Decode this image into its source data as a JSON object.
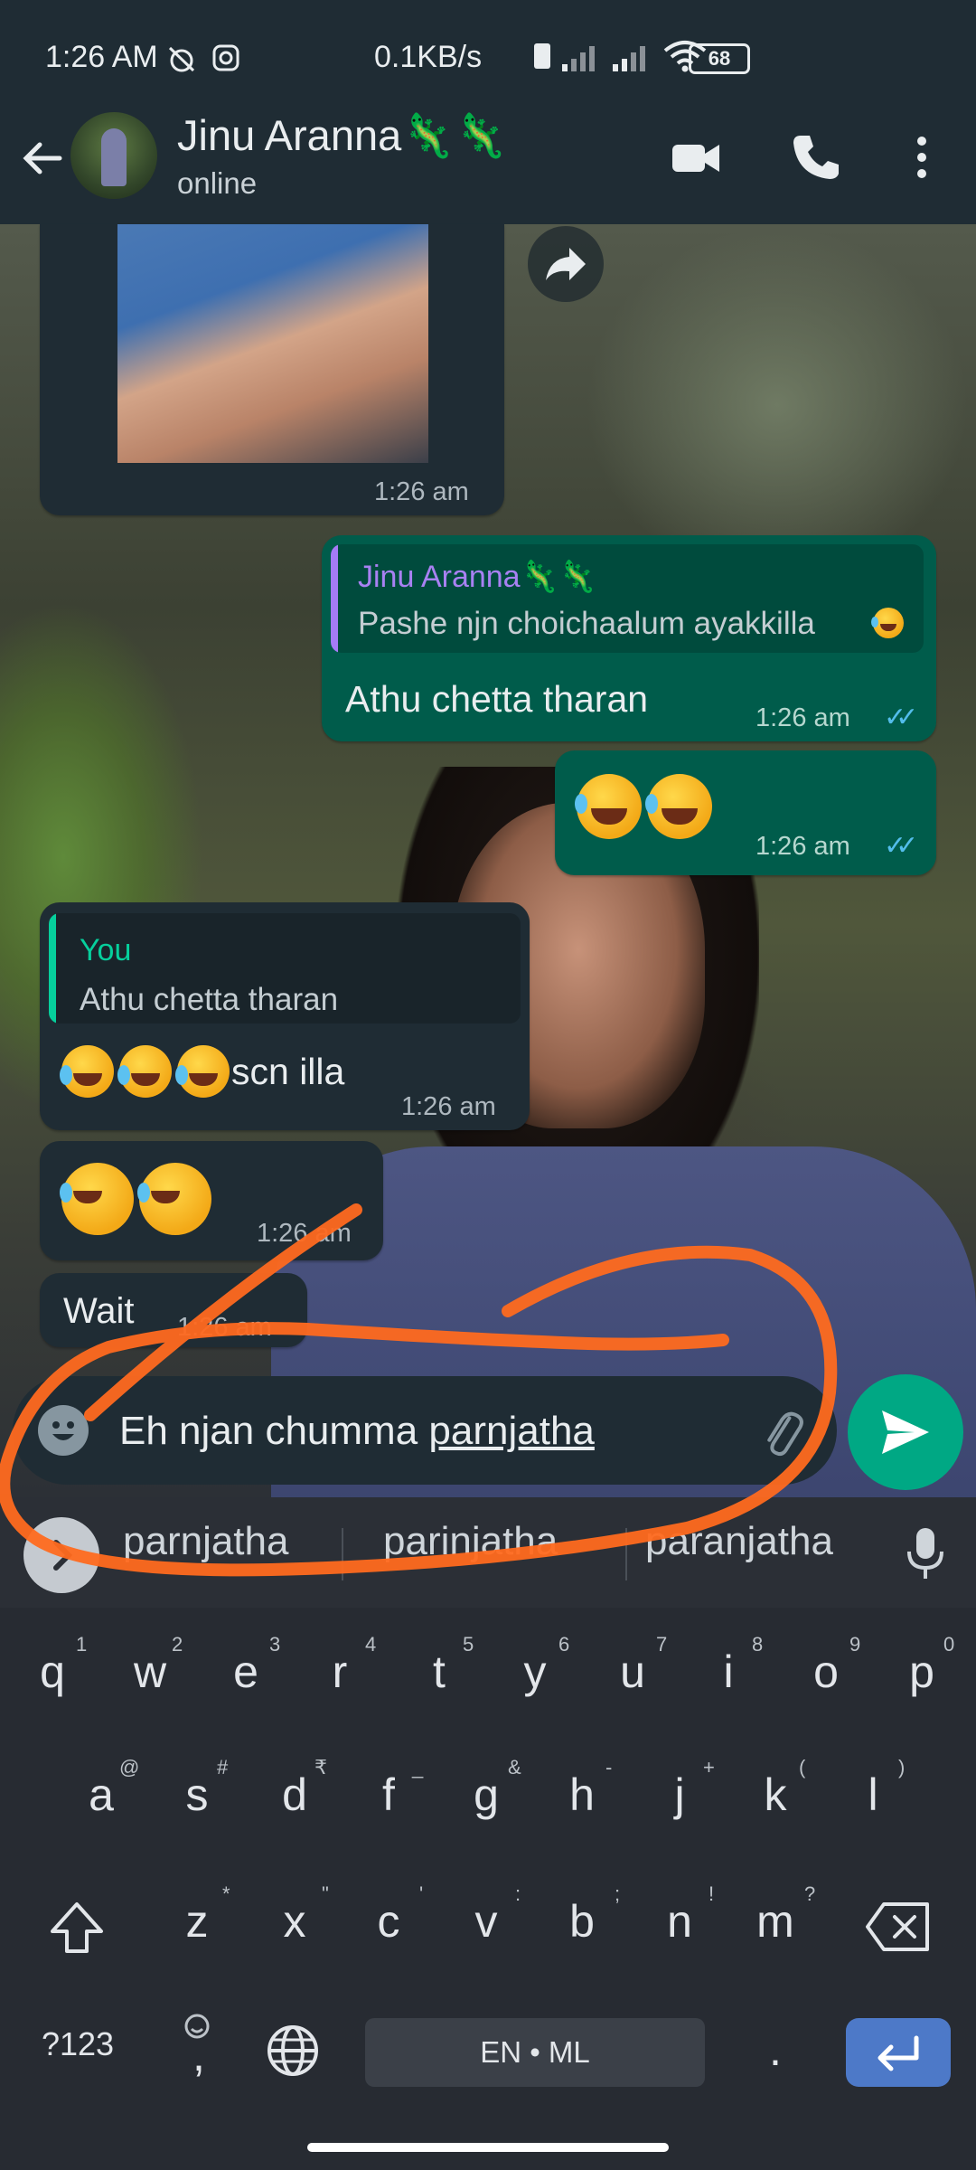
{
  "status_bar": {
    "time": "1:26 AM",
    "network_speed": "0.1KB/s",
    "battery": "68",
    "icons": [
      "alarm-icon",
      "instagram-icon",
      "volte-icon",
      "signal-icon",
      "signal-icon",
      "wifi-icon",
      "battery-icon"
    ]
  },
  "header": {
    "contact_name": "Jinu Aranna🦎🦎",
    "status": "online",
    "icons": [
      "back-arrow-icon",
      "video-call-icon",
      "voice-call-icon",
      "more-vert-icon"
    ]
  },
  "messages": [
    {
      "type": "image",
      "direction": "in",
      "time": "1:26 am"
    },
    {
      "type": "reply",
      "direction": "out",
      "quoted_name": "Jinu Aranna🦎🦎",
      "quoted_text": "Pashe njn choichaalum ayakkilla",
      "text": "Athu chetta tharan",
      "time": "1:26 am",
      "status": "read"
    },
    {
      "type": "emoji",
      "direction": "out",
      "emoji_count": 2,
      "time": "1:26 am",
      "status": "read"
    },
    {
      "type": "reply",
      "direction": "in",
      "quoted_name": "You",
      "quoted_text": "Athu chetta tharan",
      "text": "scn illa",
      "emoji_count": 3,
      "time": "1:26 am"
    },
    {
      "type": "emoji",
      "direction": "in",
      "emoji_count": 2,
      "time": "1:26 am"
    },
    {
      "type": "text",
      "direction": "in",
      "text": "Wait",
      "time": "1:26 am"
    }
  ],
  "composer": {
    "text_start": "Eh njan chumma ",
    "text_word": "parnjatha",
    "icons": [
      "emoji-icon",
      "attach-icon",
      "send-icon"
    ]
  },
  "keyboard": {
    "suggestions": [
      "parnjatha",
      "parinjatha",
      "paranjatha"
    ],
    "row1": [
      "q",
      "w",
      "e",
      "r",
      "t",
      "y",
      "u",
      "i",
      "o",
      "p"
    ],
    "row1_hints": [
      "1",
      "2",
      "3",
      "4",
      "5",
      "6",
      "7",
      "8",
      "9",
      "0"
    ],
    "row2": [
      "a",
      "s",
      "d",
      "f",
      "g",
      "h",
      "j",
      "k",
      "l"
    ],
    "row2_hints": [
      "@",
      "#",
      "₹",
      "_",
      "&",
      "-",
      "+",
      "(",
      ")"
    ],
    "row3": [
      "z",
      "x",
      "c",
      "v",
      "b",
      "n",
      "m"
    ],
    "row3_hints": [
      "*",
      "\"",
      "'",
      ":",
      ";",
      "!",
      "?"
    ],
    "symbols_label": "?123",
    "comma": ",",
    "space_label": "EN • ML",
    "period": "."
  },
  "annotation_color": "#ff6a1f"
}
